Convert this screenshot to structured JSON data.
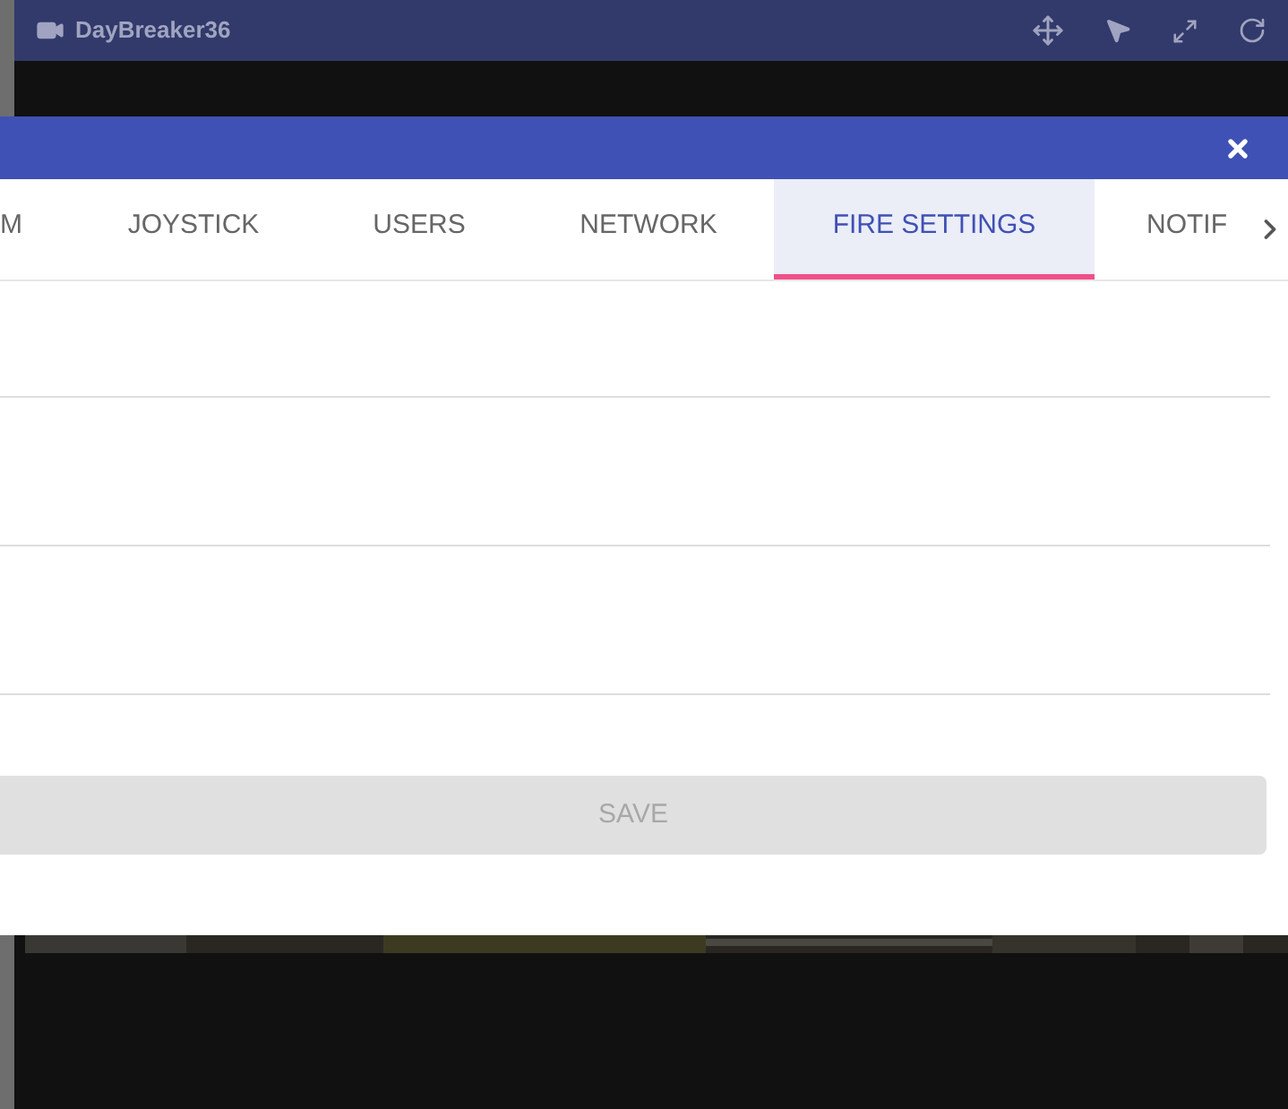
{
  "camera_bar": {
    "title": "DayBreaker36"
  },
  "tabs": [
    {
      "label": "M",
      "selected": false
    },
    {
      "label": "JOYSTICK",
      "selected": false
    },
    {
      "label": "USERS",
      "selected": false
    },
    {
      "label": "NETWORK",
      "selected": false
    },
    {
      "label": "FIRE SETTINGS",
      "selected": true
    },
    {
      "label": "NOTIF",
      "selected": false
    }
  ],
  "save_button": {
    "label": "SAVE",
    "disabled": true
  }
}
